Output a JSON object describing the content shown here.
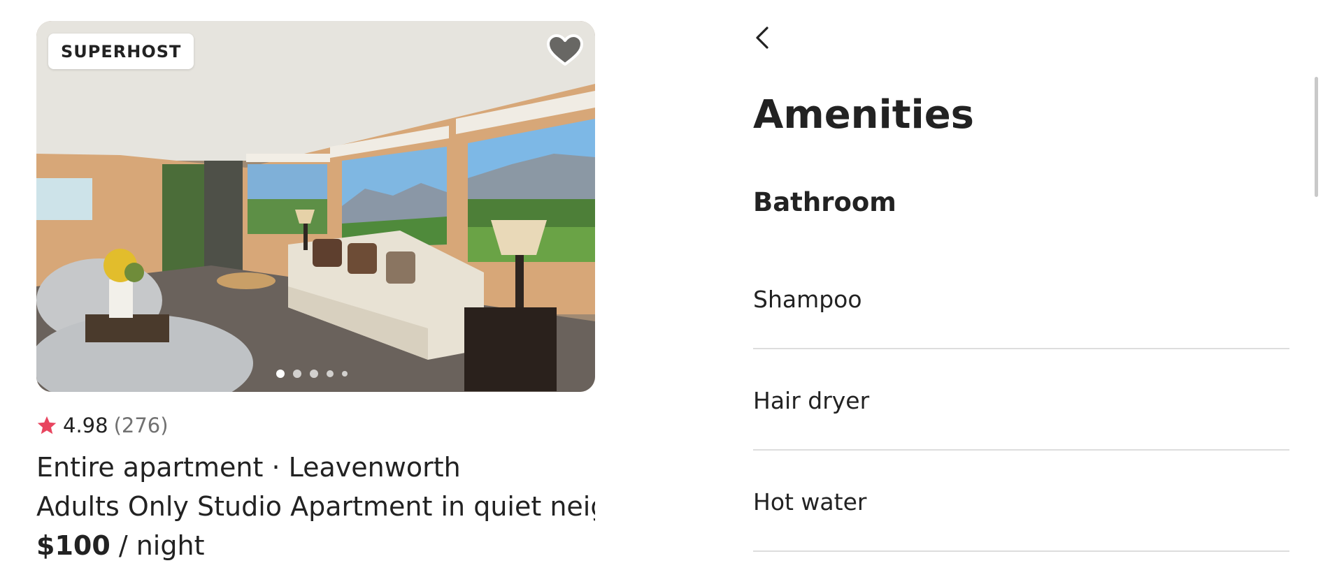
{
  "listing": {
    "badge": "SUPERHOST",
    "photo": {
      "alt": "Living room with sofa, armchairs and mountain-view windows",
      "carousel": {
        "total_dots": 5,
        "active_index": 0
      }
    },
    "rating": {
      "score": "4.98",
      "reviews": "(276)"
    },
    "title": "Entire apartment · Leavenworth",
    "name": "Adults Only Studio Apartment in quiet neig...",
    "price": {
      "amount": "$100",
      "unit": " / night"
    }
  },
  "amenities_panel": {
    "title": "Amenities",
    "section": "Bathroom",
    "items": [
      "Shampoo",
      "Hair dryer",
      "Hot water"
    ]
  },
  "colors": {
    "star": "#e8455f",
    "text": "#222222",
    "muted": "#717171",
    "divider": "#dddddd"
  },
  "icons": {
    "back": "chevron-left-icon",
    "favorite": "heart-icon",
    "rating": "star-icon"
  }
}
